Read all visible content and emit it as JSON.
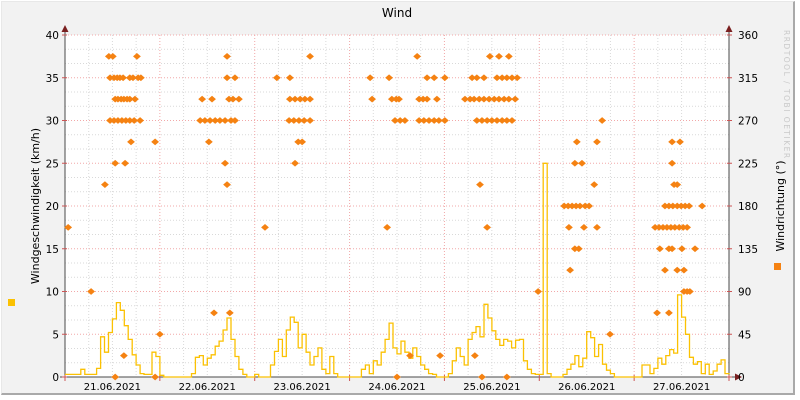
{
  "title": "Wind",
  "watermark": "RRDTOOL / TOBI OETIKER",
  "axes": {
    "left": {
      "label": "Windgeschwindigkeit (km/h)",
      "ticks": [
        0,
        5,
        10,
        15,
        20,
        25,
        30,
        35,
        40
      ],
      "max": 40
    },
    "right": {
      "label": "Windrichtung (°)",
      "ticks": [
        0,
        45,
        90,
        135,
        180,
        225,
        270,
        315,
        360
      ],
      "max": 360
    },
    "x": {
      "day_labels": [
        "21.06.2021",
        "22.06.2021",
        "23.06.2021",
        "24.06.2021",
        "25.06.2021",
        "26.06.2021",
        "27.06.2021"
      ],
      "hours_total": 168
    }
  },
  "colors": {
    "surface": "#f2f2f2",
    "plot_bg": "#ffffff",
    "grid_major": "#f2a8a8",
    "grid_minor": "#d9d9d9",
    "axis": "#4a4a4a",
    "arrow": "#7a2020",
    "tick": "#cc5555",
    "text": "#000000"
  },
  "chart_data": {
    "type": "mixed",
    "title": "Wind",
    "x_range_hours": [
      0,
      168
    ],
    "left_ylim": [
      0,
      40
    ],
    "right_ylim": [
      0,
      360
    ],
    "series": [
      {
        "name": "Windgeschwindigkeit",
        "unit": "km/h",
        "type": "line",
        "axis": "left",
        "color": "#fbc102",
        "sample_interval_hours": 1,
        "values": [
          0.3,
          0.3,
          0.3,
          0.3,
          0.9,
          0.3,
          0.3,
          0.3,
          1.0,
          4.7,
          2.9,
          5.2,
          6.8,
          8.7,
          7.8,
          6.0,
          4.4,
          2.6,
          1.4,
          0.4,
          0.3,
          0.3,
          2.9,
          2.4,
          0.2,
          0,
          0,
          0,
          0,
          0,
          0,
          0,
          0.4,
          2.3,
          2.5,
          1.4,
          2.2,
          2.6,
          3.6,
          4.2,
          5.5,
          6.9,
          4.4,
          2.4,
          0.9,
          0.3,
          0,
          0,
          0.3,
          0,
          0,
          0,
          1.4,
          3.0,
          4.4,
          2.4,
          5.5,
          7.0,
          6.4,
          3.4,
          5.0,
          2.9,
          1.4,
          2.4,
          3.4,
          0.9,
          0.4,
          2.4,
          0.4,
          0,
          0,
          0,
          0,
          0,
          0,
          0.9,
          1.4,
          0.4,
          1.9,
          1.4,
          2.9,
          4.4,
          6.3,
          3.4,
          2.7,
          4.2,
          2.9,
          2.2,
          3.4,
          2.4,
          1.4,
          0.9,
          0.4,
          0.3,
          0,
          0,
          0,
          0.4,
          1.9,
          3.4,
          2.4,
          1.4,
          4.4,
          5.2,
          5.9,
          4.7,
          8.5,
          6.9,
          5.4,
          4.4,
          3.7,
          4.4,
          4.2,
          3.4,
          4.3,
          4.4,
          1.9,
          0.9,
          0.4,
          0.3,
          0.3,
          25,
          0.4,
          0,
          0,
          0,
          0.3,
          0.9,
          1.5,
          2.5,
          1.2,
          2.2,
          5.3,
          4.6,
          2.4,
          3.8,
          1.5,
          0.8,
          0.4,
          0,
          0,
          0,
          0,
          0,
          0,
          0,
          1.4,
          1.4,
          0.4,
          1.0,
          2.2,
          1.5,
          2.5,
          3.2,
          2.8,
          9.6,
          7.0,
          5.0,
          2.3,
          1.5,
          1.8,
          0.4,
          1.5,
          0.3,
          0.7,
          1.5,
          2.0,
          0.4,
          0.3
        ]
      },
      {
        "name": "Windrichtung",
        "unit": "°",
        "type": "scatter",
        "axis": "right",
        "color": "#f58212",
        "direction_groups": [
          {
            "deg": 337.5,
            "t": [
              11.1,
              12.1,
              18.2,
              41.0,
              62.0,
              89.1,
              107.5,
              109.8,
              112.3
            ]
          },
          {
            "deg": 315.0,
            "t": [
              11.4,
              12.4,
              13.2,
              13.9,
              14.7,
              16.4,
              17.2,
              18.5,
              19.2,
              41.0,
              43.0,
              53.6,
              56.9,
              77.2,
              82.0,
              91.6,
              93.4,
              96.1,
              103.0,
              104.2,
              106.0,
              109.3,
              110.6,
              111.8,
              113.1,
              114.4
            ]
          },
          {
            "deg": 292.5,
            "t": [
              12.7,
              13.4,
              14.2,
              14.9,
              15.7,
              16.4,
              17.7,
              34.7,
              37.2,
              41.5,
              42.5,
              44.0,
              56.9,
              58.2,
              59.5,
              60.7,
              62.0,
              77.7,
              82.7,
              83.8,
              84.5,
              89.6,
              90.6,
              91.6,
              94.1,
              101.2,
              102.5,
              103.5,
              104.8,
              106.0,
              107.3,
              108.6,
              109.8,
              111.1,
              112.3,
              113.9
            ]
          },
          {
            "deg": 270.0,
            "t": [
              11.4,
              12.4,
              13.4,
              14.4,
              15.4,
              16.4,
              17.5,
              19.0,
              34.2,
              35.4,
              36.7,
              38.0,
              39.2,
              40.5,
              42.0,
              43.0,
              56.7,
              57.9,
              59.2,
              60.5,
              62.0,
              83.5,
              84.8,
              86.0,
              89.6,
              90.8,
              92.1,
              93.4,
              94.6,
              96.1,
              104.2,
              105.5,
              106.8,
              108.0,
              109.3,
              110.6,
              111.8,
              113.1,
              135.9
            ]
          },
          {
            "deg": 247.5,
            "t": [
              16.7,
              22.8,
              36.4,
              59.0,
              60.0,
              129.5,
              134.6,
              153.6,
              155.6
            ]
          },
          {
            "deg": 225.0,
            "t": [
              12.7,
              15.2,
              40.5,
              58.2,
              129.0,
              130.8,
              153.6
            ]
          },
          {
            "deg": 202.5,
            "t": [
              10.1,
              41.0,
              105.0,
              133.9,
              154.1,
              154.9
            ]
          },
          {
            "deg": 180.0,
            "t": [
              126.3,
              127.3,
              128.3,
              129.3,
              130.3,
              131.6,
              132.6,
              151.8,
              152.8,
              153.8,
              154.9,
              155.9,
              156.9,
              157.9,
              161.2
            ]
          },
          {
            "deg": 157.5,
            "t": [
              0.8,
              50.6,
              81.5,
              106.8,
              127.5,
              131.3,
              134.6,
              149.3,
              150.3,
              151.3,
              152.3,
              153.3,
              154.3,
              155.4,
              156.4,
              157.4
            ]
          },
          {
            "deg": 135.0,
            "t": [
              129.0,
              130.0,
              150.5,
              152.8,
              153.6,
              156.1,
              159.4
            ]
          },
          {
            "deg": 112.5,
            "t": [
              127.8,
              151.8,
              154.9,
              156.6
            ]
          },
          {
            "deg": 90.0,
            "t": [
              6.6,
              119.7,
              156.6,
              157.4,
              158.1
            ]
          },
          {
            "deg": 67.5,
            "t": [
              37.7,
              41.7,
              149.8,
              152.8
            ]
          },
          {
            "deg": 45.0,
            "t": [
              24.0,
              137.9
            ]
          },
          {
            "deg": 22.5,
            "t": [
              14.9,
              87.3,
              94.9,
              103.7
            ]
          },
          {
            "deg": 0.0,
            "t": [
              12.7,
              22.8,
              84.0,
              105.5,
              111.8
            ]
          }
        ]
      }
    ]
  }
}
